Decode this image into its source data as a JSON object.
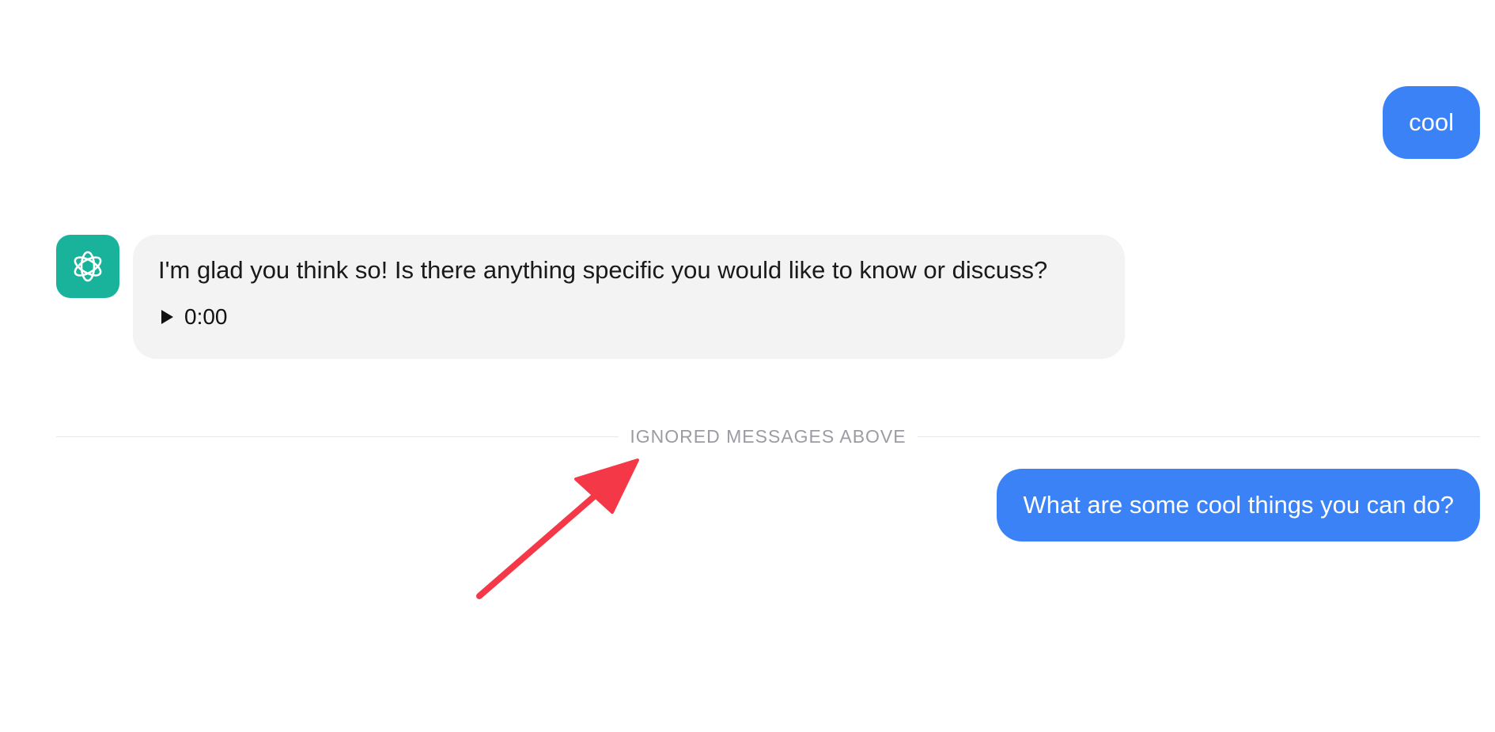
{
  "messages": [
    {
      "role": "user",
      "text": "cool"
    },
    {
      "role": "assistant",
      "text": "I'm glad you think so! Is there anything specific you would like to know or discuss?",
      "audio": {
        "time": "0:00",
        "icon": "play-icon"
      }
    },
    {
      "role": "user",
      "text": "What are some cool things you can do?"
    }
  ],
  "divider": {
    "label": "IGNORED MESSAGES ABOVE"
  },
  "assistant_avatar": {
    "icon": "openai-logo-icon",
    "color": "#19b39c"
  },
  "colors": {
    "user_bubble": "#3b82f6",
    "assistant_bubble": "#f3f3f3",
    "annotation_arrow": "#f43848",
    "divider_text": "#9b9ba3"
  }
}
